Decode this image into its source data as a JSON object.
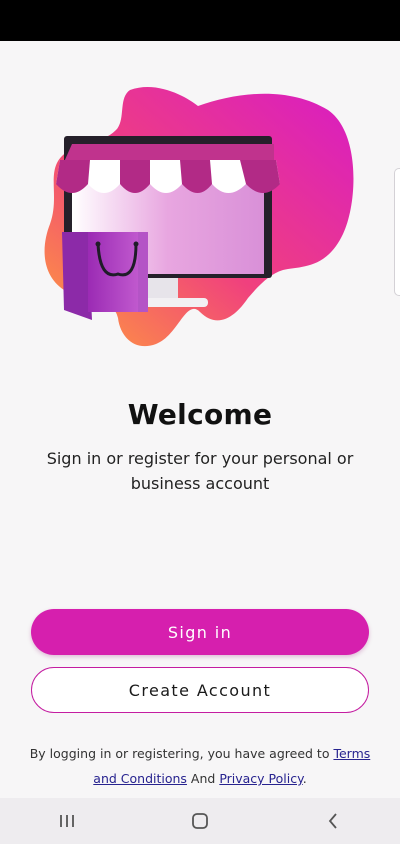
{
  "welcome": {
    "title": "Welcome",
    "subtitle": "Sign in or register for your personal or business account"
  },
  "actions": {
    "sign_in_label": "Sign in",
    "create_account_label": "Create Account"
  },
  "legal": {
    "prefix": "By logging in or registering, you have agreed to ",
    "terms_link": "Terms and Conditions",
    "middle": " And ",
    "privacy_link": "Privacy Policy",
    "suffix": "."
  },
  "icons": {
    "hero": "storefront-illustration",
    "nav_recents": "recent-apps-icon",
    "nav_home": "home-icon",
    "nav_back": "back-icon"
  },
  "colors": {
    "primary": "#d61fae",
    "outline": "#c41da1",
    "link": "#27238f",
    "background": "#f7f6f7"
  }
}
